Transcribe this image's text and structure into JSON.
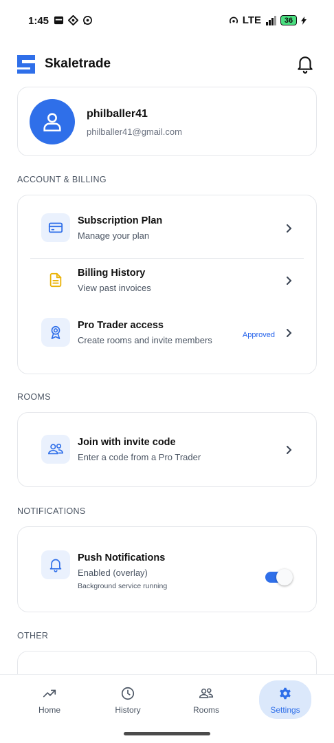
{
  "status_bar": {
    "time": "1:45",
    "network": "LTE",
    "battery": "36",
    "icons_left": [
      "news-icon",
      "sync-icon",
      "whatsapp-icon"
    ]
  },
  "app": {
    "title": "Skaletrade",
    "accent": "#2f6fe9"
  },
  "profile": {
    "name": "philballer41",
    "email": "philballer41@gmail.com"
  },
  "sections": {
    "account_billing": "ACCOUNT & BILLING",
    "rooms": "ROOMS",
    "notifications": "NOTIFICATIONS",
    "other": "OTHER"
  },
  "account_items": [
    {
      "title": "Subscription Plan",
      "subtitle": "Manage your plan",
      "icon": "credit-card-icon"
    },
    {
      "title": "Billing History",
      "subtitle": "View past invoices",
      "icon": "document-icon"
    },
    {
      "title": "Pro Trader access",
      "subtitle": "Create rooms and invite members",
      "icon": "award-icon",
      "badge": "Approved"
    }
  ],
  "rooms_items": [
    {
      "title": "Join with invite code",
      "subtitle": "Enter a code from a Pro Trader",
      "icon": "users-icon"
    }
  ],
  "notification_items": [
    {
      "title": "Push Notifications",
      "subtitle": "Enabled (overlay)",
      "detail": "Background service running",
      "icon": "bell-icon",
      "enabled": true
    }
  ],
  "bottom_nav": [
    {
      "label": "Home",
      "icon": "trend-icon",
      "active": false
    },
    {
      "label": "History",
      "icon": "clock-icon",
      "active": false
    },
    {
      "label": "Rooms",
      "icon": "users-icon",
      "active": false
    },
    {
      "label": "Settings",
      "icon": "gear-icon",
      "active": true
    }
  ]
}
